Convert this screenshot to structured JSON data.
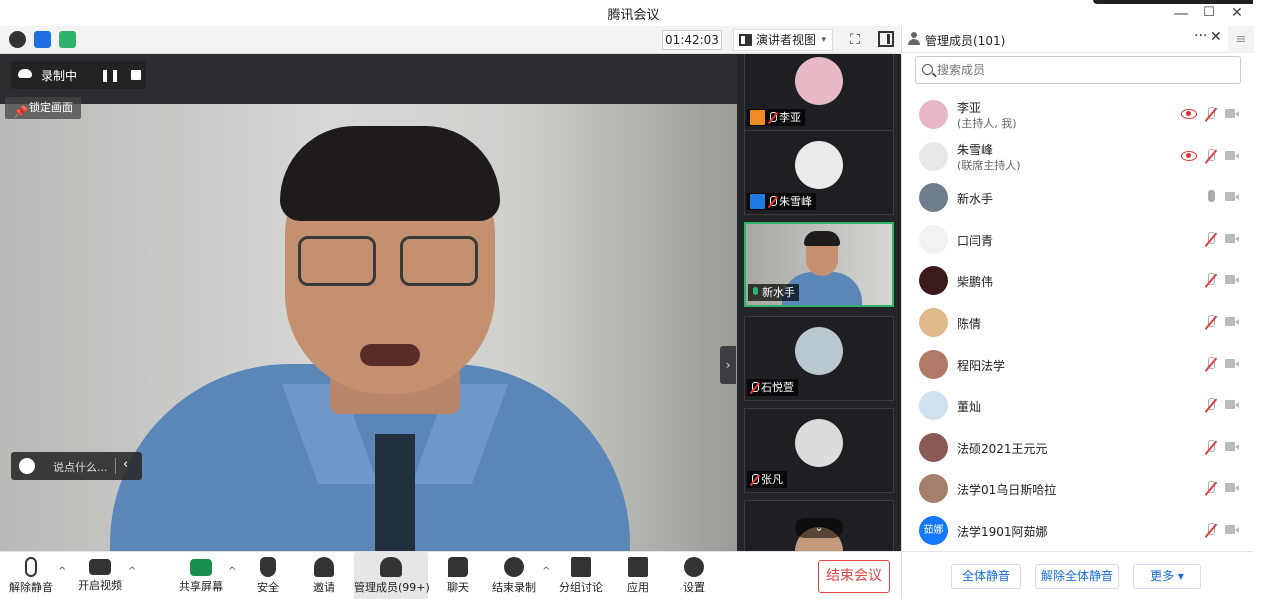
{
  "window": {
    "title": "腾讯会议",
    "minimize": "—",
    "maximize": "☐",
    "close": "✕"
  },
  "toolbar": {
    "timer": "01:42:03",
    "view_label": "演讲者视图",
    "view_caret": "▾",
    "fullscreen_glyph": "⛶"
  },
  "stage": {
    "recording_label": "录制中",
    "pause_glyph": "❚❚",
    "lock_label": "锁定画面",
    "lock_glyph": "📌",
    "chat_placeholder": "说点什么...",
    "chat_chevron": "‹",
    "collapse_glyph": "›"
  },
  "thumbnails": [
    {
      "name": "李亚",
      "role_color": "#f08a24",
      "avatar_color": "#e6b9c4",
      "mic": "off"
    },
    {
      "name": "朱雪峰",
      "role_color": "#1e7be0",
      "avatar_color": "#eaeaea",
      "mic": "off"
    },
    {
      "name": "新水手",
      "role_color": "",
      "avatar_color": "",
      "mic": "on"
    },
    {
      "name": "石悦萱",
      "role_color": "",
      "avatar_color": "#b9c7cf",
      "mic": "off"
    },
    {
      "name": "张凡",
      "role_color": "",
      "avatar_color": "#dcdcdc",
      "mic": "off"
    }
  ],
  "thumb_scroll": "⌄",
  "bottombar": {
    "items": [
      {
        "label": "解除静音"
      },
      {
        "label": "开启视频"
      },
      {
        "label": "共享屏幕"
      },
      {
        "label": "安全"
      },
      {
        "label": "邀请"
      },
      {
        "label": "管理成员(99+)"
      },
      {
        "label": "聊天"
      },
      {
        "label": "结束录制"
      },
      {
        "label": "分组讨论"
      },
      {
        "label": "应用"
      },
      {
        "label": "设置"
      }
    ],
    "caret": "^",
    "end_meeting": "结束会议"
  },
  "panel": {
    "title": "管理成员(101)",
    "more_glyph": "···",
    "close_glyph": "✕",
    "menu_glyph": "≡",
    "search_placeholder": "搜索成员",
    "members": [
      {
        "name": "李亚",
        "role": "(主持人, 我)",
        "avatar_color": "#e8b7c8",
        "avatar_text": "",
        "recording": true,
        "mic": "off"
      },
      {
        "name": "朱雪峰",
        "role": "(联席主持人)",
        "avatar_color": "#e8e8e8",
        "avatar_text": "",
        "recording": true,
        "mic": "off"
      },
      {
        "name": "新水手",
        "role": "",
        "avatar_color": "#6f7e8c",
        "avatar_text": "",
        "recording": false,
        "mic": "on"
      },
      {
        "name": "口闫青",
        "role": "",
        "avatar_color": "#f2f2f2",
        "avatar_text": "",
        "recording": false,
        "mic": "off"
      },
      {
        "name": "柴鹏伟",
        "role": "",
        "avatar_color": "#3a1a1a",
        "avatar_text": "",
        "recording": false,
        "mic": "off"
      },
      {
        "name": "陈倩",
        "role": "",
        "avatar_color": "#e0b98a",
        "avatar_text": "",
        "recording": false,
        "mic": "off"
      },
      {
        "name": "程阳法学",
        "role": "",
        "avatar_color": "#b07a66",
        "avatar_text": "",
        "recording": false,
        "mic": "off"
      },
      {
        "name": "董灿",
        "role": "",
        "avatar_color": "#cfe0ee",
        "avatar_text": "",
        "recording": false,
        "mic": "off"
      },
      {
        "name": "法硕2021王元元",
        "role": "",
        "avatar_color": "#8a5a55",
        "avatar_text": "",
        "recording": false,
        "mic": "off"
      },
      {
        "name": "法学01乌日斯哈拉",
        "role": "",
        "avatar_color": "#a4806c",
        "avatar_text": "",
        "recording": false,
        "mic": "off"
      },
      {
        "name": "法学1901阿茹娜",
        "role": "",
        "avatar_color": "#1677ff",
        "avatar_text": "茹娜",
        "recording": false,
        "mic": "off"
      }
    ],
    "footer": {
      "mute_all": "全体静音",
      "unmute_all": "解除全体静音",
      "more": "更多 ▾"
    }
  }
}
